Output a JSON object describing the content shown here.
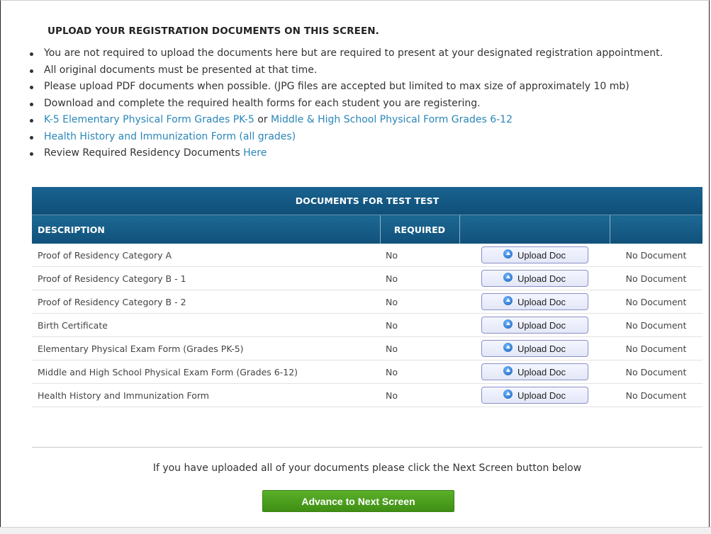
{
  "heading": "UPLOAD YOUR REGISTRATION DOCUMENTS ON THIS SCREEN.",
  "bullets": {
    "b1": "You are not required to upload the documents here but are required to present at your designated registration appointment.",
    "b2": "All original documents must be presented at that time.",
    "b3": "Please upload PDF documents when possible. (JPG files are accepted but limited to max size of approximately 10 mb)",
    "b4": "Download and complete the required health forms for each student you are registering.",
    "b5_link1": "K-5 Elementary Physical Form Grades PK-5",
    "b5_or": " or ",
    "b5_link2": "Middle & High School Physical Form Grades 6-12",
    "b6_link": "Health History and Immunization Form (all grades)",
    "b7_text": "Review Required Residency Documents ",
    "b7_link": "Here"
  },
  "table": {
    "title": "DOCUMENTS FOR TEST  TEST",
    "columns": {
      "description": "DESCRIPTION",
      "required": "REQUIRED",
      "upload": "",
      "status": ""
    },
    "upload_label": "Upload Doc",
    "rows": [
      {
        "description": "Proof of Residency Category A",
        "required": "No",
        "status": "No Document"
      },
      {
        "description": "Proof of Residency Category B - 1",
        "required": "No",
        "status": "No Document"
      },
      {
        "description": "Proof of Residency Category B - 2",
        "required": "No",
        "status": "No Document"
      },
      {
        "description": "Birth Certificate",
        "required": "No",
        "status": "No Document"
      },
      {
        "description": "Elementary Physical Exam Form (Grades PK-5)",
        "required": "No",
        "status": "No Document"
      },
      {
        "description": "Middle and High School Physical Exam Form (Grades 6-12)",
        "required": "No",
        "status": "No Document"
      },
      {
        "description": "Health History and Immunization Form",
        "required": "No",
        "status": "No Document"
      }
    ]
  },
  "footer": {
    "instruction": "If you have uploaded all of your documents please click the Next Screen button below",
    "advance_label": "Advance to Next Screen"
  },
  "colors": {
    "header_blue": "#10507a",
    "link": "#2a86b8",
    "advance_green": "#4fa020",
    "upload_border": "#8a8fc7"
  },
  "icons": {
    "upload": "upload-arrow-circle-icon"
  }
}
